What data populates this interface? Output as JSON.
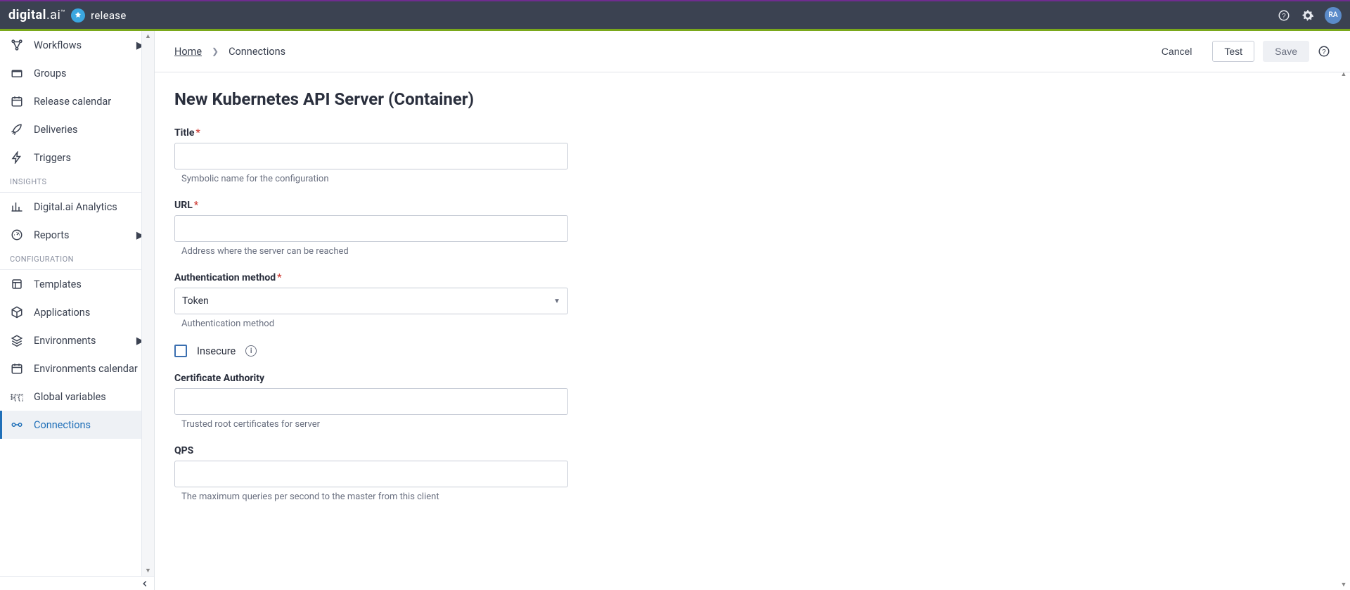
{
  "brand": {
    "logo_prefix": "digital",
    "logo_suffix": ".ai",
    "product": "release",
    "avatar_initials": "RA"
  },
  "sidebar": {
    "sections": [
      {
        "items": [
          {
            "label": "Workflows",
            "icon": "workflow-icon",
            "expandable": true
          },
          {
            "label": "Groups",
            "icon": "folder-icon"
          },
          {
            "label": "Release calendar",
            "icon": "calendar-icon"
          },
          {
            "label": "Deliveries",
            "icon": "rocket-icon"
          },
          {
            "label": "Triggers",
            "icon": "bolt-icon"
          }
        ]
      },
      {
        "title": "INSIGHTS",
        "items": [
          {
            "label": "Digital.ai Analytics",
            "icon": "chart-icon"
          },
          {
            "label": "Reports",
            "icon": "gauge-icon",
            "expandable": true
          }
        ]
      },
      {
        "title": "CONFIGURATION",
        "items": [
          {
            "label": "Templates",
            "icon": "template-icon"
          },
          {
            "label": "Applications",
            "icon": "cube-icon"
          },
          {
            "label": "Environments",
            "icon": "layers-icon",
            "expandable": true
          },
          {
            "label": "Environments calendar",
            "icon": "calendar-icon"
          },
          {
            "label": "Global variables",
            "icon": "dollar-braces-icon"
          },
          {
            "label": "Connections",
            "icon": "connection-icon",
            "active": true
          }
        ]
      }
    ]
  },
  "breadcrumb": {
    "home": "Home",
    "current": "Connections"
  },
  "actions": {
    "cancel": "Cancel",
    "test": "Test",
    "save": "Save"
  },
  "page": {
    "title": "New Kubernetes API Server (Container)",
    "fields": {
      "title": {
        "label": "Title",
        "required": true,
        "value": "",
        "helper": "Symbolic name for the configuration"
      },
      "url": {
        "label": "URL",
        "required": true,
        "value": "",
        "helper": "Address where the server can be reached"
      },
      "auth": {
        "label": "Authentication method",
        "required": true,
        "value": "Token",
        "helper": "Authentication method"
      },
      "insecure": {
        "label": "Insecure",
        "checked": false
      },
      "ca": {
        "label": "Certificate Authority",
        "value": "",
        "helper": "Trusted root certificates for server"
      },
      "qps": {
        "label": "QPS",
        "value": "",
        "helper": "The maximum queries per second to the master from this client"
      }
    }
  }
}
